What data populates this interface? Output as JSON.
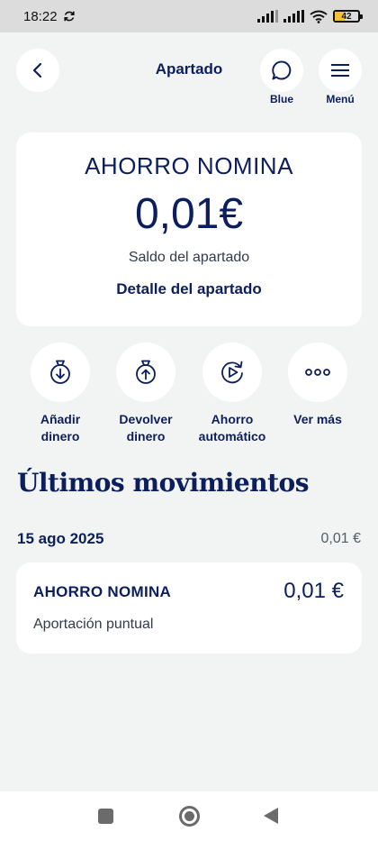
{
  "status_bar": {
    "time": "18:22",
    "battery": "42",
    "battery_level": 0.42
  },
  "header": {
    "title": "Apartado",
    "blue_label": "Blue",
    "menu_label": "Menú"
  },
  "summary": {
    "name": "AHORRO NOMINA",
    "amount": "0,01€",
    "subtitle": "Saldo del apartado",
    "detail_link": "Detalle del apartado"
  },
  "actions": [
    {
      "line1": "Añadir",
      "line2": "dinero",
      "icon": "add-money-icon"
    },
    {
      "line1": "Devolver",
      "line2": "dinero",
      "icon": "return-money-icon"
    },
    {
      "line1": "Ahorro",
      "line2": "automático",
      "icon": "auto-save-icon"
    },
    {
      "line1": "Ver más",
      "line2": "",
      "icon": "more-icon"
    }
  ],
  "movements": {
    "title": "Últimos movimientos",
    "groups": [
      {
        "date": "15 ago 2025",
        "total": "0,01 €",
        "items": [
          {
            "name": "AHORRO NOMINA",
            "amount": "0,01 €",
            "description": "Aportación puntual"
          }
        ]
      }
    ]
  },
  "colors": {
    "primary": "#0c1f5c",
    "background": "#f2f4f3",
    "card": "#ffffff",
    "status_bar": "#dcdcdc",
    "battery": "#f1c232"
  }
}
